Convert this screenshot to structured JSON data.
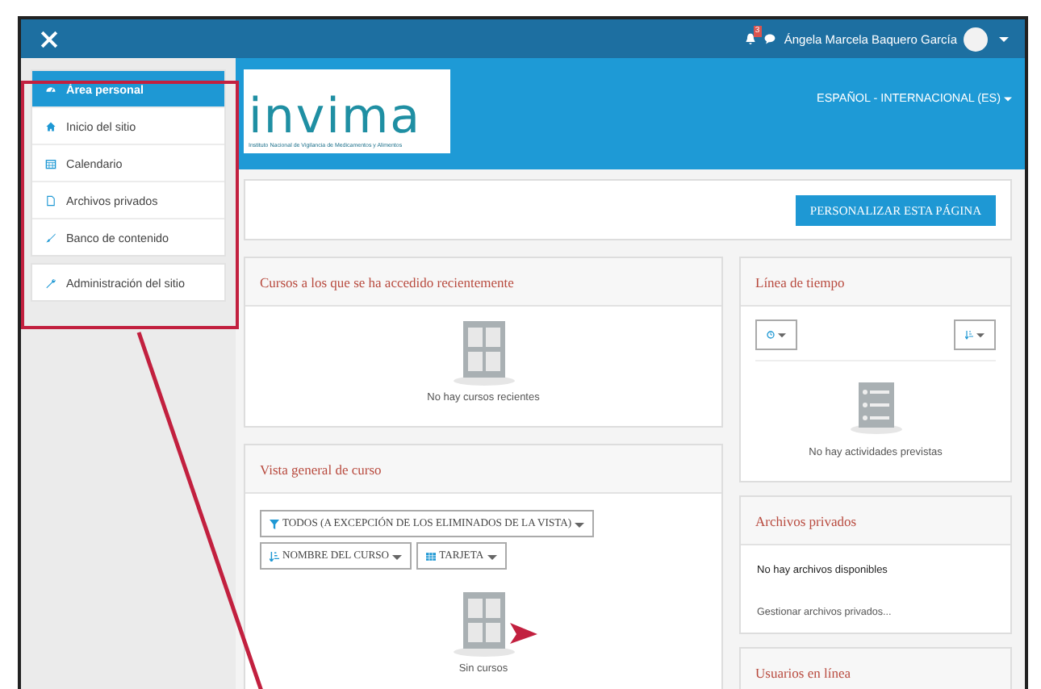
{
  "top_bar": {
    "notification_count": "3",
    "user_name": "Ángela Marcela Baquero García"
  },
  "sidebar": {
    "groups": [
      [
        {
          "label": "Área personal",
          "selected": true
        },
        {
          "label": "Inicio del sitio",
          "selected": false
        },
        {
          "label": "Calendario",
          "selected": false
        },
        {
          "label": "Archivos privados",
          "selected": false
        },
        {
          "label": "Banco de contenido",
          "selected": false
        }
      ],
      [
        {
          "label": "Administración del sitio",
          "selected": false
        }
      ]
    ]
  },
  "header": {
    "logo_text": "invima",
    "logo_subtitle": "Instituto Nacional de Vigilancia de Medicamentos y Alimentos",
    "language": "ESPAÑOL - INTERNACIONAL (ES)"
  },
  "customize_button": "PERSONALIZAR ESTA PÁGINA",
  "recent_courses": {
    "title": "Cursos a los que se ha accedido recientemente",
    "empty_text": "No hay cursos recientes"
  },
  "course_overview": {
    "title": "Vista general de curso",
    "filters": [
      "TODOS (A EXCEPCIÓN DE LOS ELIMINADOS DE LA VISTA)",
      "NOMBRE DEL CURSO",
      "TARJETA"
    ],
    "empty_text": "Sin cursos"
  },
  "timeline": {
    "title": "Línea de tiempo",
    "empty_text": "No hay actividades previstas"
  },
  "private_files": {
    "title": "Archivos privados",
    "empty_text": "No hay archivos disponibles",
    "link": "Gestionar archivos privados..."
  },
  "online_users": {
    "title": "Usuarios en línea"
  }
}
